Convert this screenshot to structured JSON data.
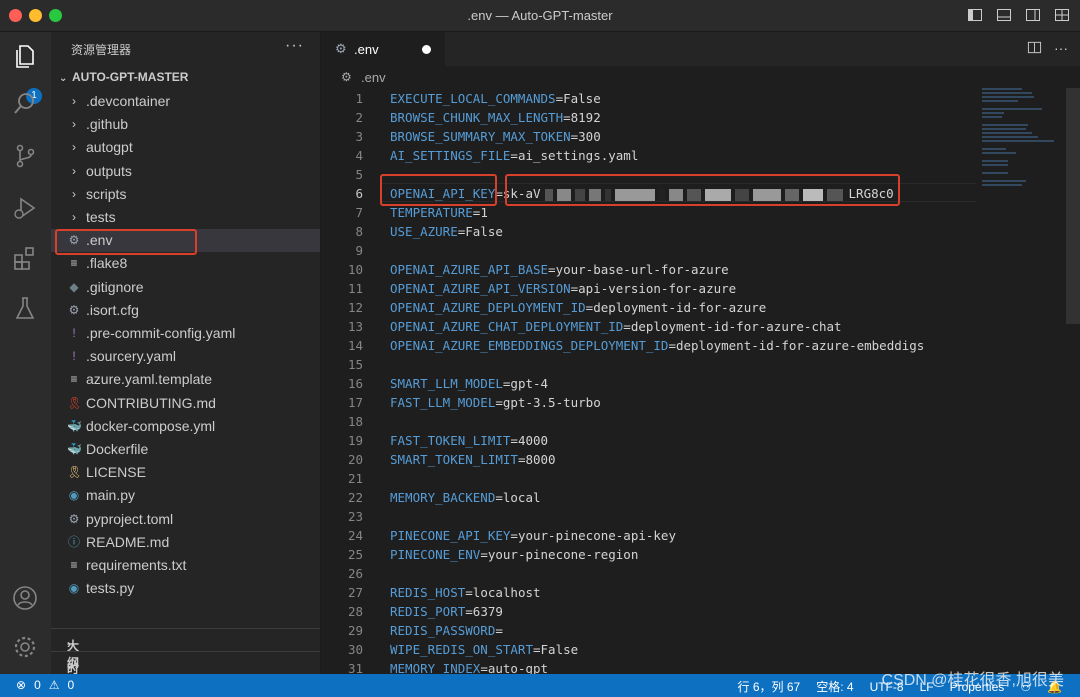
{
  "window": {
    "title": ".env — Auto-GPT-master"
  },
  "activity": {
    "explorer_badge": "1"
  },
  "sidebar": {
    "header": "资源管理器",
    "more": "···",
    "root": "AUTO-GPT-MASTER",
    "items": [
      {
        "label": ".devcontainer",
        "kind": "folder"
      },
      {
        "label": ".github",
        "kind": "folder"
      },
      {
        "label": "autogpt",
        "kind": "folder"
      },
      {
        "label": "outputs",
        "kind": "folder"
      },
      {
        "label": "scripts",
        "kind": "folder"
      },
      {
        "label": "tests",
        "kind": "folder"
      },
      {
        "label": ".env",
        "kind": "gear"
      },
      {
        "label": ".flake8",
        "kind": "lines"
      },
      {
        "label": ".gitignore",
        "kind": "git"
      },
      {
        "label": ".isort.cfg",
        "kind": "gear"
      },
      {
        "label": ".pre-commit-config.yaml",
        "kind": "yaml"
      },
      {
        "label": ".sourcery.yaml",
        "kind": "yaml"
      },
      {
        "label": "azure.yaml.template",
        "kind": "lines"
      },
      {
        "label": "CONTRIBUTING.md",
        "kind": "ribbon"
      },
      {
        "label": "docker-compose.yml",
        "kind": "docker"
      },
      {
        "label": "Dockerfile",
        "kind": "docker"
      },
      {
        "label": "LICENSE",
        "kind": "license"
      },
      {
        "label": "main.py",
        "kind": "python"
      },
      {
        "label": "pyproject.toml",
        "kind": "gear"
      },
      {
        "label": "README.md",
        "kind": "info"
      },
      {
        "label": "requirements.txt",
        "kind": "lines"
      },
      {
        "label": "tests.py",
        "kind": "python"
      }
    ],
    "outline": "大纲",
    "timeline": "时间线"
  },
  "tab": {
    "label": ".env"
  },
  "breadcrumb": ".env",
  "code_lines": [
    {
      "n": "1",
      "key": "EXECUTE_LOCAL_COMMANDS",
      "val": "=False"
    },
    {
      "n": "2",
      "key": "BROWSE_CHUNK_MAX_LENGTH",
      "val": "=8192"
    },
    {
      "n": "3",
      "key": "BROWSE_SUMMARY_MAX_TOKEN",
      "val": "=300"
    },
    {
      "n": "4",
      "key": "AI_SETTINGS_FILE",
      "val": "=ai_settings.yaml"
    },
    {
      "n": "5",
      "key": "",
      "val": ""
    },
    {
      "n": "6",
      "key": "OPENAI_API_KEY",
      "val": "=sk-aV",
      "tail": "LRG8c0"
    },
    {
      "n": "7",
      "key": "TEMPERATURE",
      "val": "=1"
    },
    {
      "n": "8",
      "key": "USE_AZURE",
      "val": "=False"
    },
    {
      "n": "9",
      "key": "",
      "val": ""
    },
    {
      "n": "10",
      "key": "OPENAI_AZURE_API_BASE",
      "val": "=your-base-url-for-azure"
    },
    {
      "n": "11",
      "key": "OPENAI_AZURE_API_VERSION",
      "val": "=api-version-for-azure"
    },
    {
      "n": "12",
      "key": "OPENAI_AZURE_DEPLOYMENT_ID",
      "val": "=deployment-id-for-azure"
    },
    {
      "n": "13",
      "key": "OPENAI_AZURE_CHAT_DEPLOYMENT_ID",
      "val": "=deployment-id-for-azure-chat"
    },
    {
      "n": "14",
      "key": "OPENAI_AZURE_EMBEDDINGS_DEPLOYMENT_ID",
      "val": "=deployment-id-for-azure-embeddigs"
    },
    {
      "n": "15",
      "key": "",
      "val": ""
    },
    {
      "n": "16",
      "key": "SMART_LLM_MODEL",
      "val": "=gpt-4"
    },
    {
      "n": "17",
      "key": "FAST_LLM_MODEL",
      "val": "=gpt-3.5-turbo"
    },
    {
      "n": "18",
      "key": "",
      "val": ""
    },
    {
      "n": "19",
      "key": "FAST_TOKEN_LIMIT",
      "val": "=4000"
    },
    {
      "n": "20",
      "key": "SMART_TOKEN_LIMIT",
      "val": "=8000"
    },
    {
      "n": "21",
      "key": "",
      "val": ""
    },
    {
      "n": "22",
      "key": "MEMORY_BACKEND",
      "val": "=local"
    },
    {
      "n": "23",
      "key": "",
      "val": ""
    },
    {
      "n": "24",
      "key": "PINECONE_API_KEY",
      "val": "=your-pinecone-api-key"
    },
    {
      "n": "25",
      "key": "PINECONE_ENV",
      "val": "=your-pinecone-region"
    },
    {
      "n": "26",
      "key": "",
      "val": ""
    },
    {
      "n": "27",
      "key": "REDIS_HOST",
      "val": "=localhost"
    },
    {
      "n": "28",
      "key": "REDIS_PORT",
      "val": "=6379"
    },
    {
      "n": "29",
      "key": "REDIS_PASSWORD",
      "val": "="
    },
    {
      "n": "30",
      "key": "WIPE_REDIS_ON_START",
      "val": "=False"
    },
    {
      "n": "31",
      "key": "MEMORY_INDEX",
      "val": "=auto-gpt"
    }
  ],
  "status": {
    "errors": "0",
    "warnings": "0",
    "position": "行 6，列 67",
    "spaces": "空格: 4",
    "encoding": "UTF-8",
    "eol": "LF",
    "language": "Properties"
  },
  "watermark": "CSDN @桂花很香,旭很美",
  "colors": {
    "key": "#569cd6",
    "value": "#d4d4d4",
    "highlight": "#d9402c",
    "statusbar": "#0e70c0"
  }
}
